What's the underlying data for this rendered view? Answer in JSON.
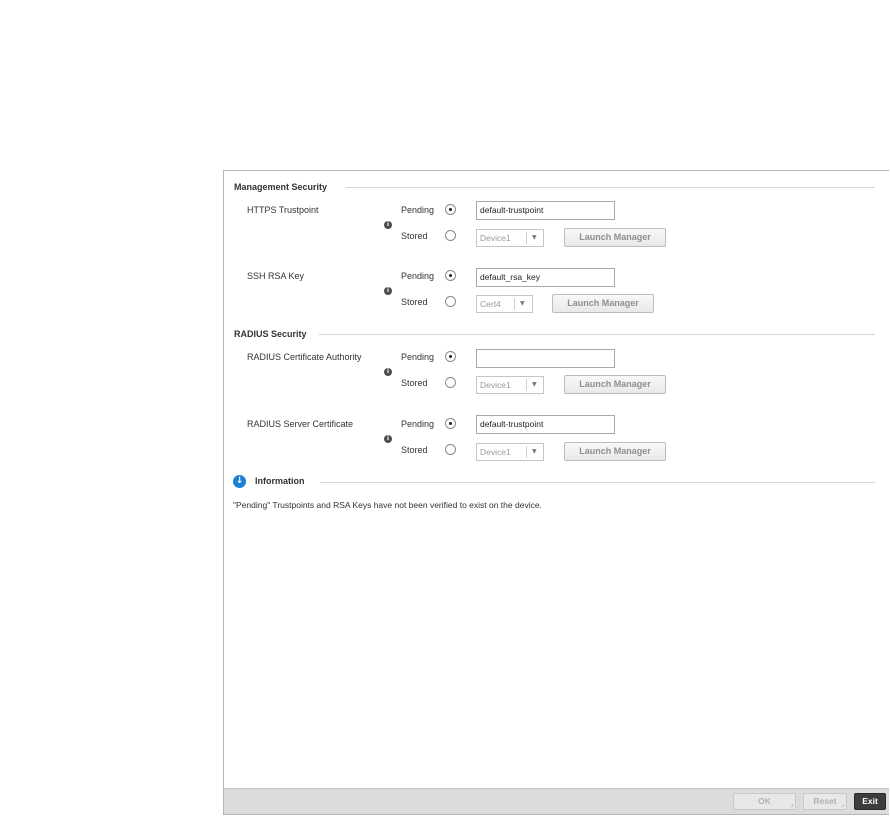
{
  "sections": {
    "management": {
      "title": "Management Security",
      "https": {
        "label": "HTTPS Trustpoint",
        "pending_label": "Pending",
        "stored_label": "Stored",
        "pending_value": "default-trustpoint",
        "stored_value": "Device1",
        "launch_label": "Launch Manager",
        "selected": "pending"
      },
      "ssh": {
        "label": "SSH RSA Key",
        "pending_label": "Pending",
        "stored_label": "Stored",
        "pending_value": "default_rsa_key",
        "stored_value": "Cert4",
        "launch_label": "Launch Manager",
        "selected": "pending"
      }
    },
    "radius": {
      "title": "RADIUS Security",
      "ca": {
        "label": "RADIUS Certificate Authority",
        "pending_label": "Pending",
        "stored_label": "Stored",
        "pending_value": "",
        "stored_value": "Device1",
        "launch_label": "Launch Manager",
        "selected": "pending"
      },
      "server": {
        "label": "RADIUS Server Certificate",
        "pending_label": "Pending",
        "stored_label": "Stored",
        "pending_value": "default-trustpoint",
        "stored_value": "Device1",
        "launch_label": "Launch Manager",
        "selected": "pending"
      }
    },
    "information": {
      "title": "Information",
      "text": "\"Pending\" Trustpoints and RSA Keys have not been verified to exist on the device."
    }
  },
  "footer": {
    "ok_label": "OK",
    "reset_label": "Reset",
    "exit_label": "Exit"
  },
  "icons": {
    "info_small": "i",
    "info_expand": "↓",
    "dropdown": "▼"
  },
  "colors": {
    "accent": "#1e7fd6",
    "footer_bg": "#dcdcdc",
    "exit_bg": "#3d3d3d"
  }
}
